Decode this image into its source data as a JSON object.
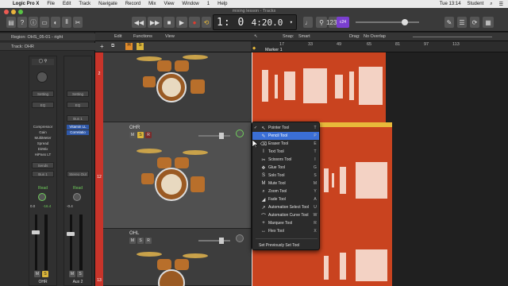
{
  "menubar": {
    "app": "Logic Pro X",
    "items": [
      "File",
      "Edit",
      "Track",
      "Navigate",
      "Record",
      "Mix",
      "View",
      "Window",
      "1",
      "Help"
    ],
    "clock": "Tue 13:14",
    "user": "Student"
  },
  "window": {
    "title": "mixing lesson - Tracks"
  },
  "transport": {
    "position": "1: 0",
    "tempo": "4:20.0",
    "key_badge": "c24"
  },
  "inspector": {
    "region_label": "Region: OHS_05-01 - right",
    "track_label": "Track: OHR",
    "strip_left": {
      "setting": "Setting",
      "eq": "EQ",
      "plugins": [
        "Compressor",
        "Gain",
        "MultiMeter",
        "Spread",
        "DirMix",
        "HiPass LT"
      ],
      "send": "Sends",
      "io": "Bus 1",
      "read": "Read",
      "volume": "0.0",
      "pan": "-16.4",
      "name": "OHR",
      "m": "M",
      "s": "S"
    },
    "strip_right": {
      "setting": "Setting",
      "eq": "EQ",
      "io_top": "Bus 1",
      "plugins": [
        "Vitamin LL",
        "Correlatio"
      ],
      "io": "Stereo Out",
      "read": "Read",
      "volume": "-0.4",
      "name": "Aux 2",
      "m": "M",
      "s": "S"
    }
  },
  "editbar": {
    "edit": "Edit",
    "functions": "Functions",
    "view": "View",
    "snap_label": "Snap:",
    "snap_value": "Smart",
    "drag_label": "Drag:",
    "drag_value": "No Overlap"
  },
  "ruler": {
    "bars": [
      "17",
      "33",
      "49",
      "65",
      "81",
      "97",
      "113"
    ],
    "marker": "Marker 1"
  },
  "tracks": [
    {
      "number": "2",
      "name": ""
    },
    {
      "number": "12",
      "name": "OHR"
    },
    {
      "number": "13",
      "name": "OHL"
    }
  ],
  "track_buttons": {
    "m": "M",
    "s": "S",
    "r": "R",
    "h": "H"
  },
  "tool_menu": {
    "items": [
      {
        "label": "Pointer Tool",
        "key": "T",
        "icon": "pointer-icon",
        "glyph": "↖",
        "checked": true
      },
      {
        "label": "Pencil Tool",
        "key": "P",
        "icon": "pencil-icon",
        "glyph": "✎",
        "checked": false,
        "highlighted": true
      },
      {
        "label": "Eraser Tool",
        "key": "E",
        "icon": "eraser-icon",
        "glyph": "⌫",
        "checked": false
      },
      {
        "label": "Text Tool",
        "key": "T",
        "icon": "text-icon",
        "glyph": "I",
        "checked": false
      },
      {
        "label": "Scissors Tool",
        "key": "I",
        "icon": "scissors-icon",
        "glyph": "✂",
        "checked": false
      },
      {
        "label": "Glue Tool",
        "key": "G",
        "icon": "glue-icon",
        "glyph": "❖",
        "checked": false
      },
      {
        "label": "Solo Tool",
        "key": "S",
        "icon": "solo-icon",
        "glyph": "S",
        "checked": false
      },
      {
        "label": "Mute Tool",
        "key": "M",
        "icon": "mute-icon",
        "glyph": "M",
        "checked": false
      },
      {
        "label": "Zoom Tool",
        "key": "Y",
        "icon": "zoom-icon",
        "glyph": "⌕",
        "checked": false
      },
      {
        "label": "Fade Tool",
        "key": "A",
        "icon": "fade-icon",
        "glyph": "◢",
        "checked": false
      },
      {
        "label": "Automation Select Tool",
        "key": "U",
        "icon": "automation-select-icon",
        "glyph": "↗",
        "checked": false
      },
      {
        "label": "Automation Curve Tool",
        "key": "W",
        "icon": "automation-curve-icon",
        "glyph": "⌒",
        "checked": false
      },
      {
        "label": "Marquee Tool",
        "key": "R",
        "icon": "marquee-icon",
        "glyph": "+",
        "checked": false
      },
      {
        "label": "Flex Tool",
        "key": "X",
        "icon": "flex-icon",
        "glyph": "↔",
        "checked": false
      }
    ],
    "footer": "Set Previously Set Tool"
  },
  "colors": {
    "region": "#c9431f",
    "highlight": "#3b6fd6",
    "track_number": "#c8342a",
    "lcd_text": "#f0f0f0"
  }
}
